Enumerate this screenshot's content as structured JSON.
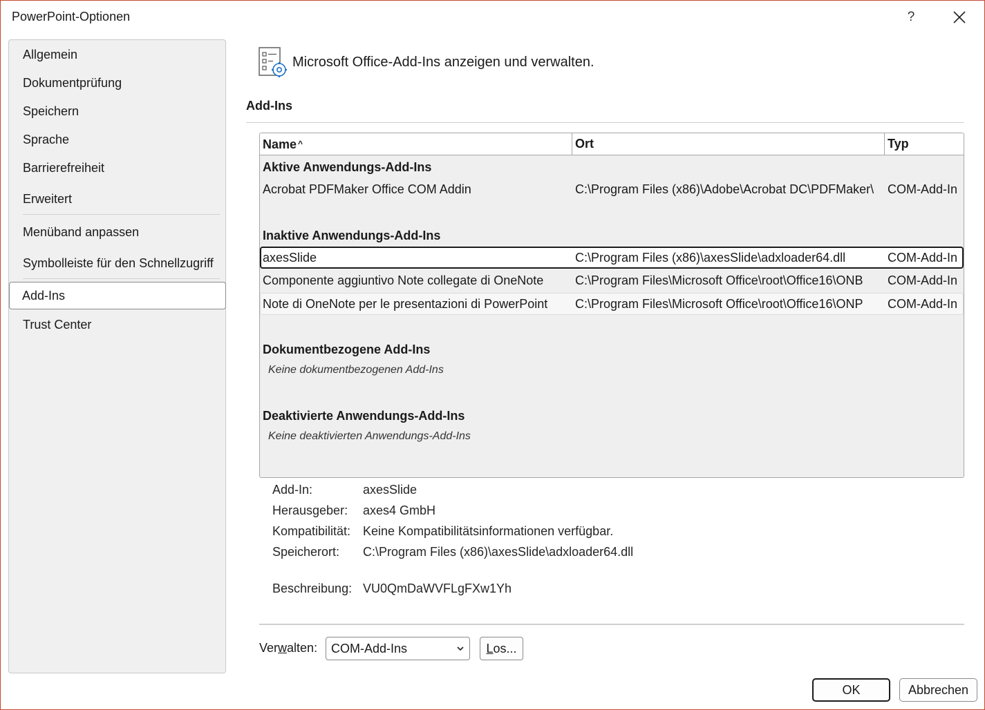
{
  "window": {
    "title": "PowerPoint-Optionen",
    "help_glyph": "?",
    "close_icon": "close-icon"
  },
  "sidebar": {
    "items": [
      {
        "label": "Allgemein"
      },
      {
        "label": "Dokumentprüfung"
      },
      {
        "label": "Speichern"
      },
      {
        "label": "Sprache"
      },
      {
        "label": "Barrierefreiheit"
      },
      {
        "label": "Erweitert"
      },
      {
        "label": "Menüband anpassen"
      },
      {
        "label": "Symbolleiste für den Schnellzugriff"
      },
      {
        "label": "Add-Ins",
        "selected": true
      },
      {
        "label": "Trust Center"
      }
    ]
  },
  "main": {
    "header_text": "Microsoft Office-Add-Ins anzeigen und verwalten.",
    "header_icon": "addins-settings-icon",
    "section_title": "Add-Ins",
    "table": {
      "columns": [
        "Name",
        "Ort",
        "Typ"
      ],
      "sort_indicator": "^",
      "groups": {
        "active": {
          "title": "Aktive Anwendungs-Add-Ins",
          "rows": [
            {
              "name": "Acrobat PDFMaker Office COM Addin",
              "location": "C:\\Program Files (x86)\\Adobe\\Acrobat DC\\PDFMaker\\",
              "type": "COM-Add-In"
            }
          ]
        },
        "inactive": {
          "title": "Inaktive Anwendungs-Add-Ins",
          "rows": [
            {
              "name": "axesSlide",
              "location": "C:\\Program Files (x86)\\axesSlide\\adxloader64.dll",
              "type": "COM-Add-In"
            },
            {
              "name": "Componente aggiuntivo Note collegate di OneNote",
              "location": "C:\\Program Files\\Microsoft Office\\root\\Office16\\ONB",
              "type": "COM-Add-In"
            },
            {
              "name": "Note di OneNote per le presentazioni di PowerPoint",
              "location": "C:\\Program Files\\Microsoft Office\\root\\Office16\\ONP",
              "type": "COM-Add-In"
            }
          ]
        },
        "document": {
          "title": "Dokumentbezogene Add-Ins",
          "empty_text": "Keine dokumentbezogenen Add-Ins"
        },
        "disabled": {
          "title": "Deaktivierte Anwendungs-Add-Ins",
          "empty_text": "Keine deaktivierten Anwendungs-Add-Ins"
        }
      }
    },
    "details": {
      "addin_label": "Add-In:",
      "addin_value": "axesSlide",
      "publisher_label": "Herausgeber:",
      "publisher_value": "axes4 GmbH",
      "compat_label": "Kompatibilität:",
      "compat_value": "Keine Kompatibilitätsinformationen verfügbar.",
      "location_label": "Speicherort:",
      "location_value": "C:\\Program Files (x86)\\axesSlide\\adxloader64.dll",
      "description_label": "Beschreibung:",
      "description_value": "VU0QmDaWVFLgFXw1Yh"
    },
    "manage": {
      "label_pre": "Ver",
      "label_accel": "w",
      "label_post": "alten:",
      "selected": "COM-Add-Ins",
      "go_accel": "L",
      "go_post": "os..."
    }
  },
  "footer": {
    "ok_label": "OK",
    "cancel_label": "Abbrechen"
  }
}
